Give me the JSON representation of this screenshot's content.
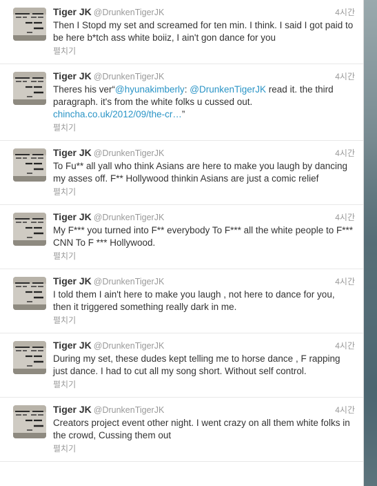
{
  "tweets": [
    {
      "name": "Tiger JK",
      "handle": "@DrunkenTigerJK",
      "time": "4시간",
      "parts": [
        {
          "type": "text",
          "text": "Then I Stopd my set and screamed for ten min. I think. I said I got paid to be here b*tch ass white boiiz, I ain't gon dance for you"
        }
      ],
      "expand": "펼치기"
    },
    {
      "name": "Tiger JK",
      "handle": "@DrunkenTigerJK",
      "time": "4시간",
      "parts": [
        {
          "type": "text",
          "text": "Theres his ver“"
        },
        {
          "type": "link",
          "text": "@hyunakimberly"
        },
        {
          "type": "text",
          "text": ": "
        },
        {
          "type": "link",
          "text": "@DrunkenTigerJK"
        },
        {
          "type": "text",
          "text": " read it. the third paragraph. it's from the white folks u cussed out. "
        },
        {
          "type": "link",
          "text": "chincha.co.uk/2012/09/the-cr…"
        },
        {
          "type": "text",
          "text": "”"
        }
      ],
      "expand": "펼치기"
    },
    {
      "name": "Tiger JK",
      "handle": "@DrunkenTigerJK",
      "time": "4시간",
      "parts": [
        {
          "type": "text",
          "text": "To Fu** all yall who think Asians are here to make you laugh by dancing my asses off. F** Hollywood thinkin Asians are just a comic relief"
        }
      ],
      "expand": "펼치기"
    },
    {
      "name": "Tiger JK",
      "handle": "@DrunkenTigerJK",
      "time": "4시간",
      "parts": [
        {
          "type": "text",
          "text": "My F*** you turned into F** everybody To F*** all the white people to F*** CNN To F *** Hollywood."
        }
      ],
      "expand": "펼치기"
    },
    {
      "name": "Tiger JK",
      "handle": "@DrunkenTigerJK",
      "time": "4시간",
      "parts": [
        {
          "type": "text",
          "text": "I told them I ain't here to make you laugh , not here to dance for you, then it triggered something really dark in me."
        }
      ],
      "expand": "펼치기"
    },
    {
      "name": "Tiger JK",
      "handle": "@DrunkenTigerJK",
      "time": "4시간",
      "parts": [
        {
          "type": "text",
          "text": "During my set, these dudes kept telling me to horse dance , F rapping just dance. I had to cut all my song short. Without self control."
        }
      ],
      "expand": "펼치기"
    },
    {
      "name": "Tiger JK",
      "handle": "@DrunkenTigerJK",
      "time": "4시간",
      "parts": [
        {
          "type": "text",
          "text": "Creators project event other night. I went crazy on all them white folks in the crowd, Cussing them out"
        }
      ],
      "expand": "펼치기"
    }
  ],
  "avatar_lettering": "ISTHOU: MONI ... WE'D ALL B ... SKN",
  "colors": {
    "link": "#2a94c6",
    "text": "#333333",
    "muted": "#999999"
  }
}
